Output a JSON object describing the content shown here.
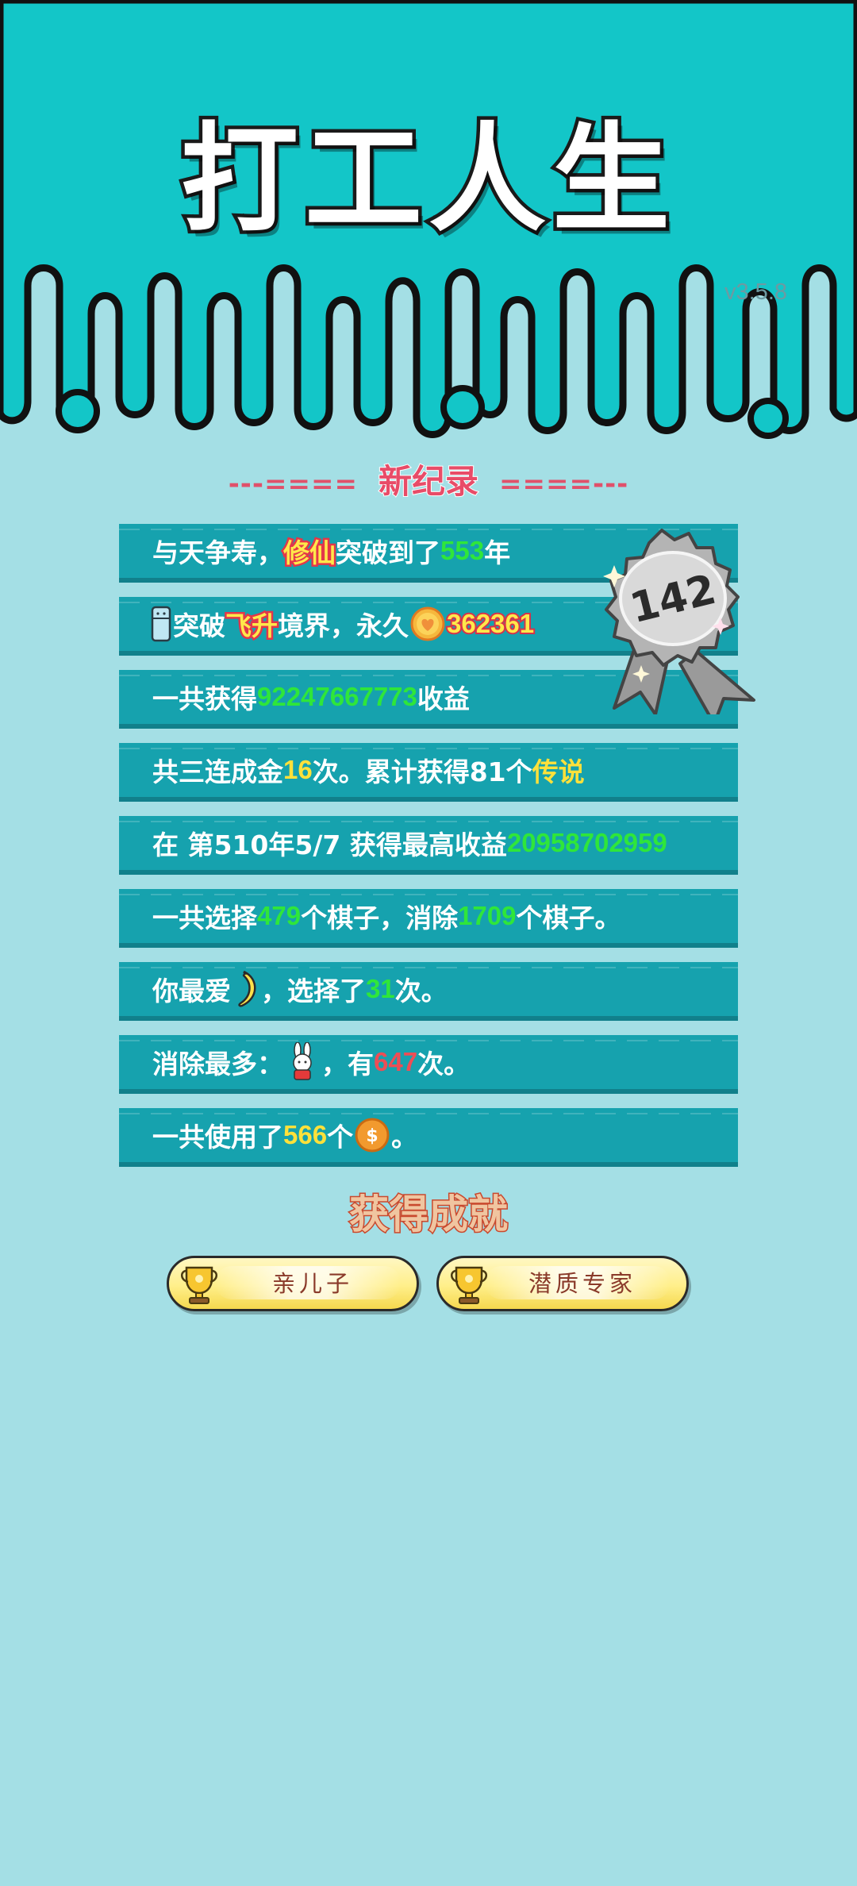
{
  "header": {
    "title": "打工人生",
    "version": "v3.5.8"
  },
  "record_banner": {
    "left_dashes": "---====",
    "title": "新纪录",
    "right_dashes": "====---"
  },
  "medal": {
    "rank": "142"
  },
  "stats": {
    "row1": {
      "prefix": "与天争寿，",
      "highlight": "修仙",
      "mid": "突破到了",
      "value": "553",
      "suffix": "年"
    },
    "row2": {
      "text1": "突破",
      "highlight": "飞升",
      "text2": "境界，永久",
      "value": "362361"
    },
    "row3": {
      "prefix": "一共获得",
      "value": "92247667773",
      "suffix": "收益"
    },
    "row4": {
      "prefix": "共三连成金",
      "count": "16",
      "mid": "次。累计获得81个",
      "highlight": "传说"
    },
    "row5": {
      "prefix": "在 第510年5/7 获得最高收益",
      "value": "20958702959"
    },
    "row6": {
      "prefix": "一共选择",
      "chosen": "479",
      "mid": "个棋子，消除",
      "eliminated": "1709",
      "suffix": "个棋子。"
    },
    "row7": {
      "prefix": "你最爱",
      "mid": "，选择了",
      "value": "31",
      "suffix": "次。"
    },
    "row8": {
      "prefix": "消除最多：",
      "mid": "，有",
      "value": "647",
      "suffix": "次。"
    },
    "row9": {
      "prefix": "一共使用了",
      "value": "566",
      "mid": "个",
      "suffix": "。"
    }
  },
  "achievements": {
    "title": "获得成就",
    "items": [
      {
        "label": "亲儿子",
        "icon": "trophy-icon"
      },
      {
        "label": "潜质专家",
        "icon": "trophy-icon"
      }
    ]
  },
  "colors": {
    "header_bg": "#13c6c8",
    "page_bg": "#a4dfe5",
    "row_bg": "#16a2ae",
    "value_green": "#2fe63a",
    "value_yellow": "#ffe13a",
    "value_red": "#ee4d55"
  }
}
